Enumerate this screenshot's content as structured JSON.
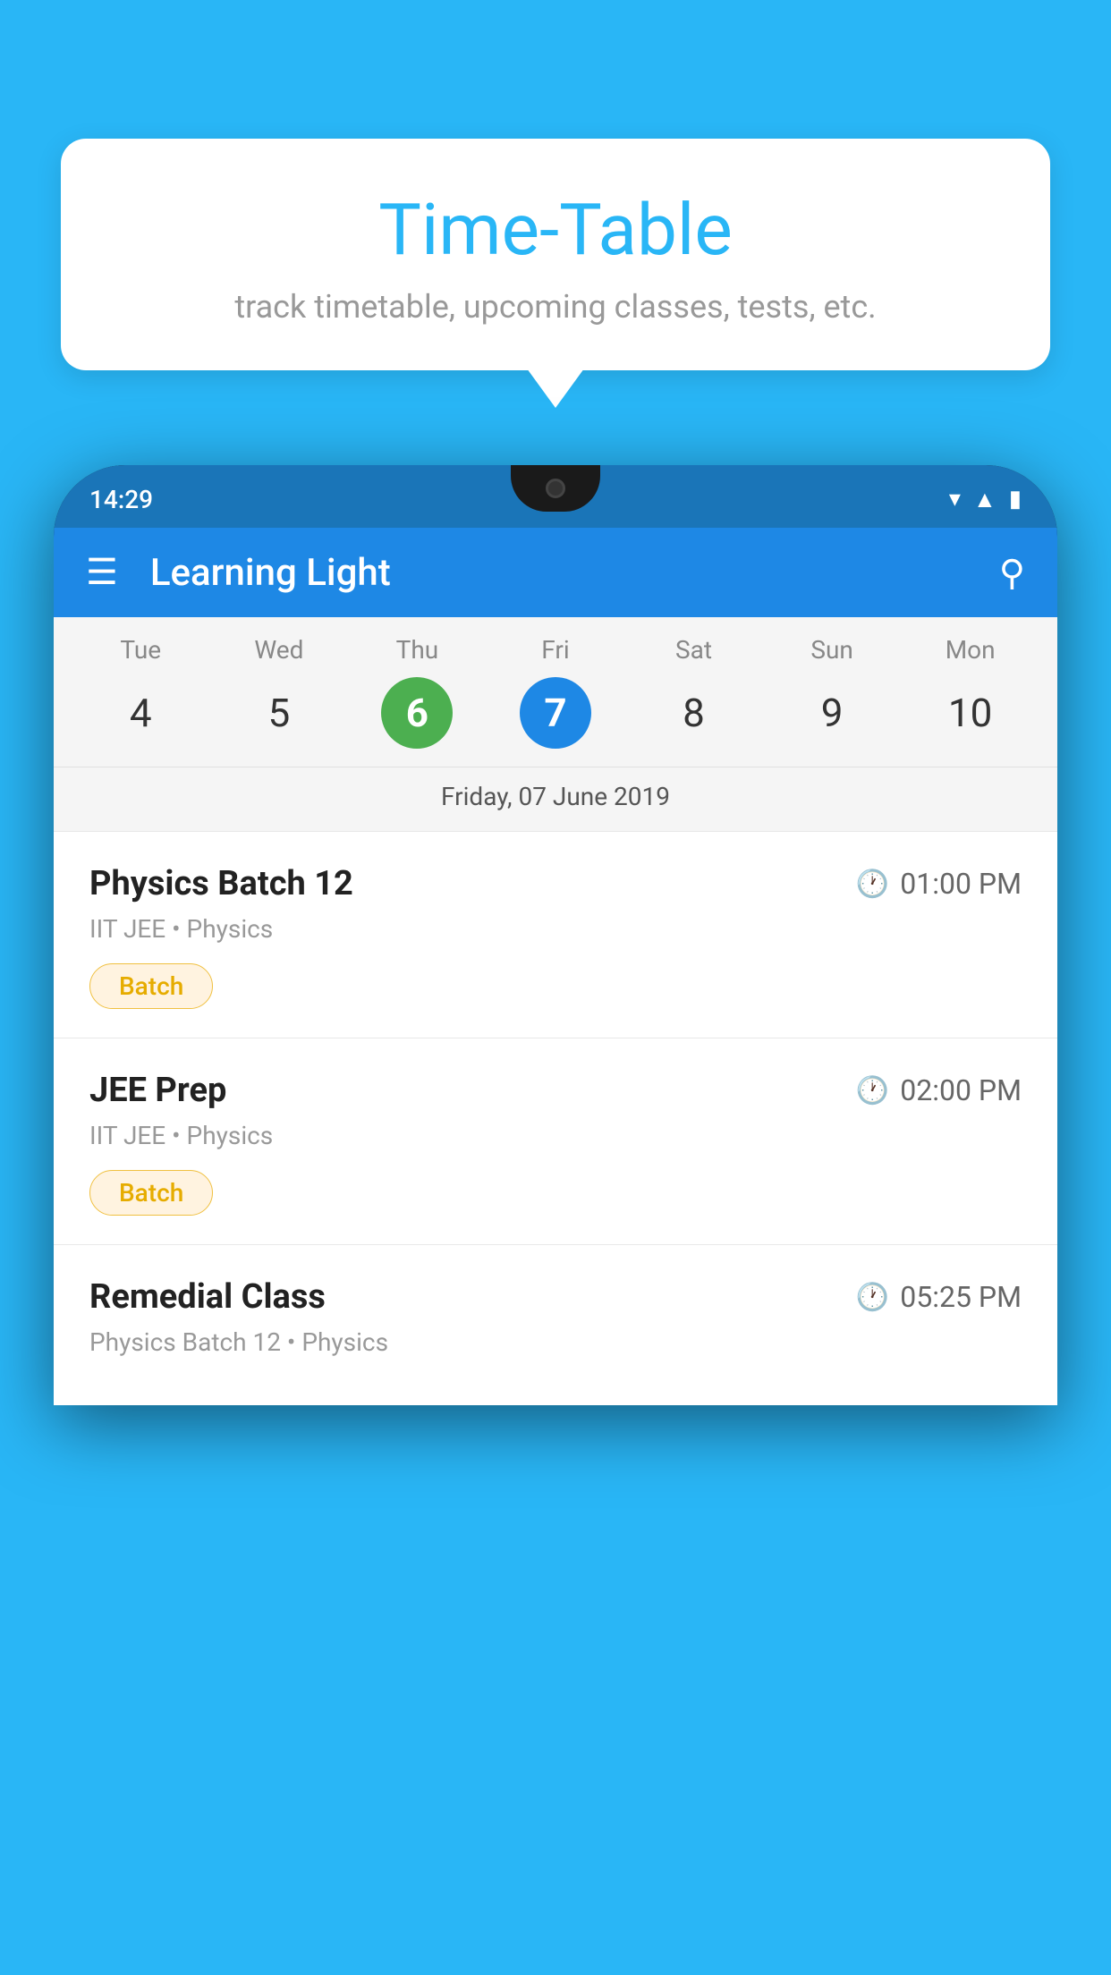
{
  "background_color": "#29B6F6",
  "tooltip": {
    "title": "Time-Table",
    "subtitle": "track timetable, upcoming classes, tests, etc."
  },
  "phone": {
    "status_bar": {
      "time": "14:29"
    },
    "app_bar": {
      "title": "Learning Light"
    },
    "calendar": {
      "days": [
        {
          "name": "Tue",
          "num": "4",
          "state": "normal"
        },
        {
          "name": "Wed",
          "num": "5",
          "state": "normal"
        },
        {
          "name": "Thu",
          "num": "6",
          "state": "today"
        },
        {
          "name": "Fri",
          "num": "7",
          "state": "selected"
        },
        {
          "name": "Sat",
          "num": "8",
          "state": "normal"
        },
        {
          "name": "Sun",
          "num": "9",
          "state": "normal"
        },
        {
          "name": "Mon",
          "num": "10",
          "state": "normal"
        }
      ],
      "selected_date_label": "Friday, 07 June 2019"
    },
    "classes": [
      {
        "name": "Physics Batch 12",
        "time": "01:00 PM",
        "meta": "IIT JEE • Physics",
        "badge": "Batch"
      },
      {
        "name": "JEE Prep",
        "time": "02:00 PM",
        "meta": "IIT JEE • Physics",
        "badge": "Batch"
      },
      {
        "name": "Remedial Class",
        "time": "05:25 PM",
        "meta": "Physics Batch 12 • Physics",
        "badge": null
      }
    ]
  }
}
